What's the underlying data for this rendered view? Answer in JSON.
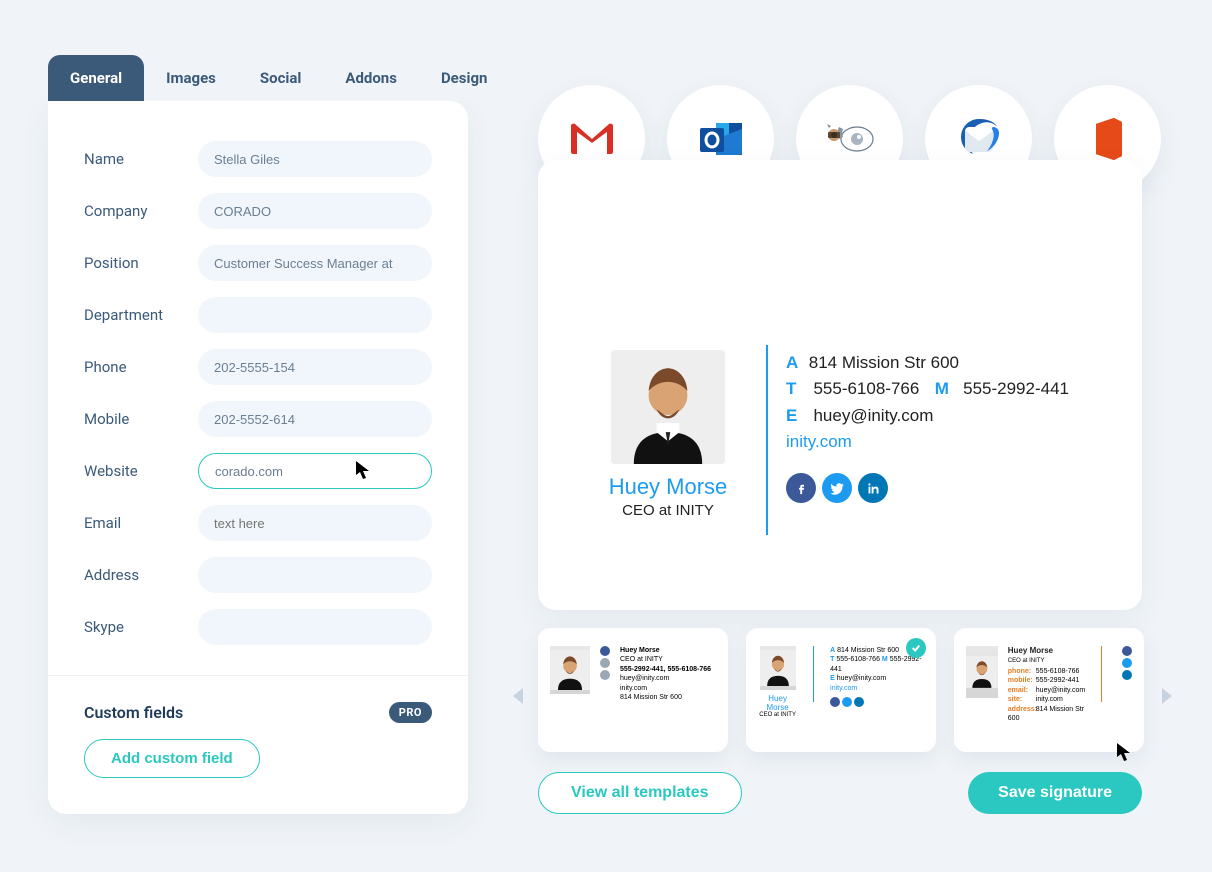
{
  "tabs": [
    "General",
    "Images",
    "Social",
    "Addons",
    "Design"
  ],
  "activeTab": 0,
  "form": {
    "name": {
      "label": "Name",
      "value": "Stella Giles"
    },
    "company": {
      "label": "Company",
      "value": "CORADO"
    },
    "position": {
      "label": "Position",
      "value": "Customer Success Manager at"
    },
    "department": {
      "label": "Department",
      "value": ""
    },
    "phone": {
      "label": "Phone",
      "value": "202-5555-154"
    },
    "mobile": {
      "label": "Mobile",
      "value": "202-5552-614"
    },
    "website": {
      "label": "Website",
      "value": "corado.com"
    },
    "email": {
      "label": "Email",
      "placeholder": "text here",
      "value": ""
    },
    "address": {
      "label": "Address",
      "value": ""
    },
    "skype": {
      "label": "Skype",
      "value": ""
    }
  },
  "custom": {
    "heading": "Custom fields",
    "badge": "PRO",
    "button": "Add custom field"
  },
  "clients": [
    "gmail",
    "outlook",
    "applemail",
    "thunderbird",
    "office"
  ],
  "preview": {
    "name": "Huey Morse",
    "title": "CEO at INITY",
    "address": "814 Mission Str 600",
    "phone": "555-6108-766",
    "mobile": "555-2992-441",
    "email": "huey@inity.com",
    "site": "inity.com",
    "labels": {
      "a": "A",
      "t": "T",
      "m": "M",
      "e": "E"
    }
  },
  "templates": [
    {
      "name": "Huey Morse",
      "title": "CEO at INITY",
      "phones": "555-2992-441, 555-6108-766",
      "email": "huey@inity.com",
      "site": "inity.com",
      "address": "814 Mission Str 600",
      "selected": false
    },
    {
      "name": "Huey Morse",
      "title": "CEO at INITY",
      "address": "814 Mission Str 600",
      "phone": "555-6108-766",
      "mobile": "555-2992-441",
      "email": "huey@inity.com",
      "site": "inity.com",
      "selected": true
    },
    {
      "name": "Huey Morse",
      "title": "CEO at INITY",
      "phone": "555-6108-766",
      "mobile": "555-2992-441",
      "email": "huey@inity.com",
      "site": "inity.com",
      "address": "814 Mission Str 600",
      "selected": false
    }
  ],
  "buttons": {
    "viewAll": "View all templates",
    "save": "Save signature"
  }
}
